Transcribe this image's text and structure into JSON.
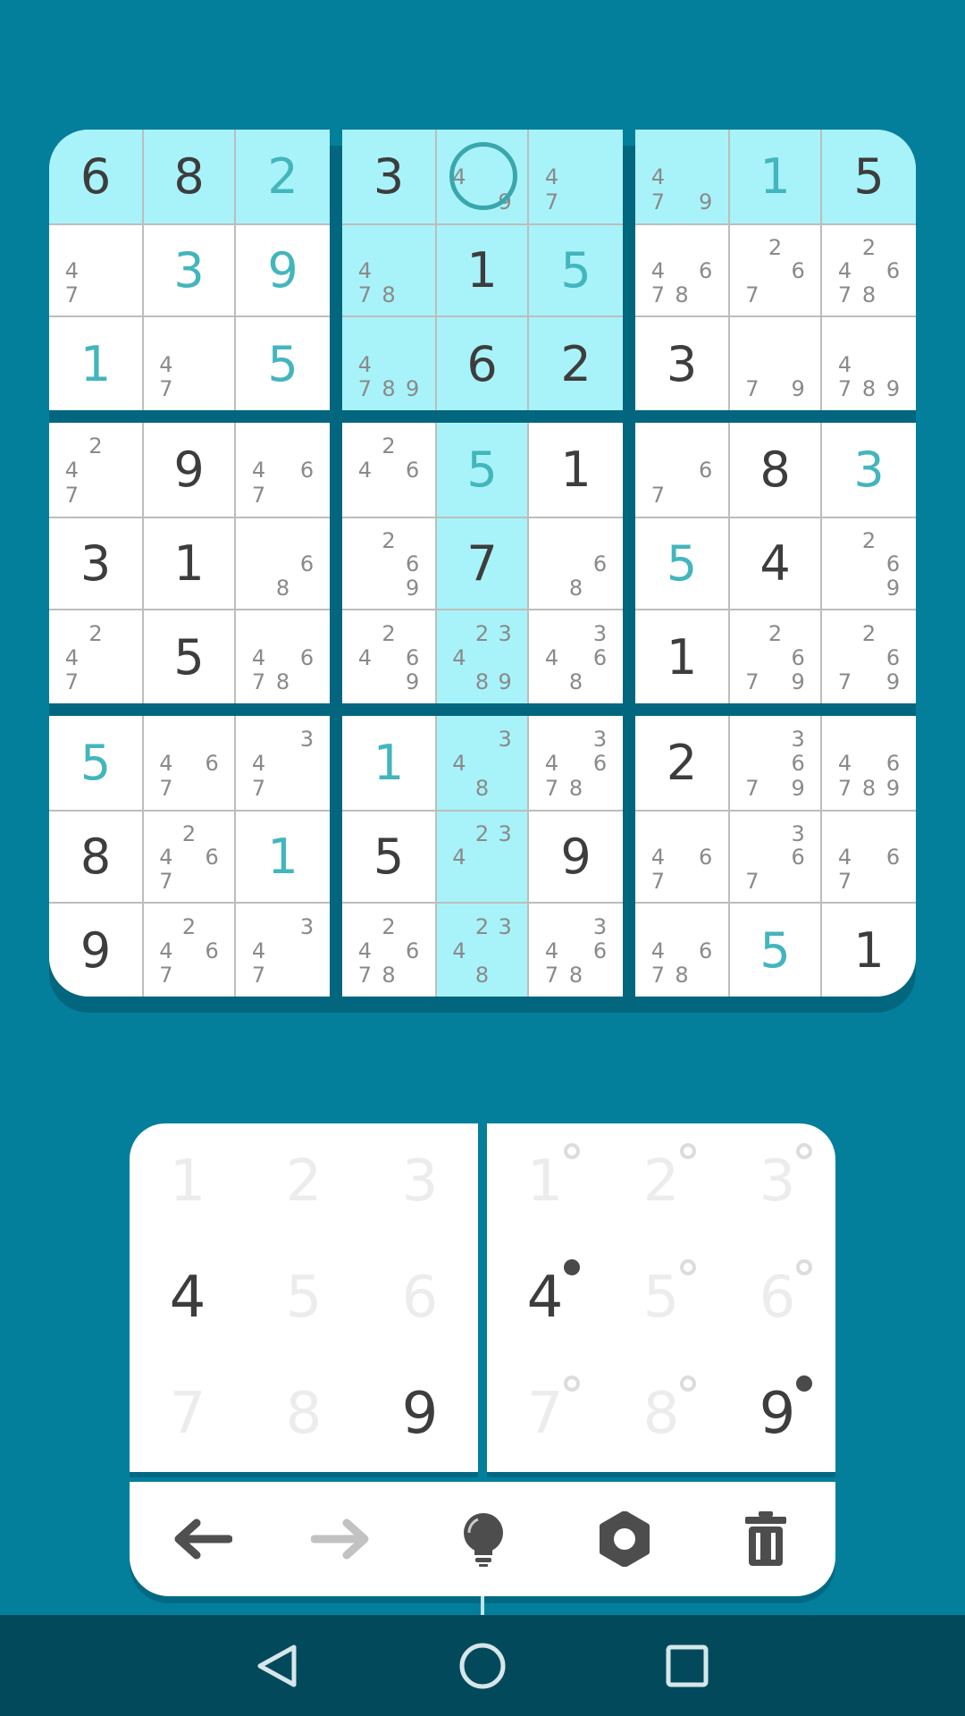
{
  "board": {
    "rows": [
      [
        {
          "v": "6"
        },
        {
          "v": "8"
        },
        {
          "v": "2",
          "g": true
        },
        {
          "v": "3"
        },
        {
          "n": [
            "4",
            "9"
          ]
        },
        {
          "n": [
            "4",
            "7"
          ]
        },
        {
          "n": [
            "4",
            "7",
            "9"
          ]
        },
        {
          "v": "1",
          "g": true
        },
        {
          "v": "5"
        }
      ],
      [
        {
          "n": [
            "4",
            "7"
          ]
        },
        {
          "v": "3",
          "g": true
        },
        {
          "v": "9",
          "g": true
        },
        {
          "n": [
            "4",
            "7",
            "8"
          ]
        },
        {
          "v": "1"
        },
        {
          "v": "5",
          "g": true
        },
        {
          "n": [
            "4",
            "6",
            "7",
            "8"
          ]
        },
        {
          "n": [
            "2",
            "6",
            "7"
          ]
        },
        {
          "n": [
            "2",
            "4",
            "6",
            "7",
            "8"
          ]
        }
      ],
      [
        {
          "v": "1",
          "g": true
        },
        {
          "n": [
            "4",
            "7"
          ]
        },
        {
          "v": "5",
          "g": true
        },
        {
          "n": [
            "4",
            "7",
            "8",
            "9"
          ]
        },
        {
          "v": "6"
        },
        {
          "v": "2"
        },
        {
          "v": "3"
        },
        {
          "n": [
            "7",
            "9"
          ]
        },
        {
          "n": [
            "4",
            "7",
            "8",
            "9"
          ]
        }
      ],
      [
        {
          "n": [
            "2",
            "4",
            "7"
          ]
        },
        {
          "v": "9"
        },
        {
          "n": [
            "4",
            "6",
            "7"
          ]
        },
        {
          "n": [
            "2",
            "4",
            "6"
          ]
        },
        {
          "v": "5",
          "g": true
        },
        {
          "v": "1"
        },
        {
          "n": [
            "6",
            "7"
          ]
        },
        {
          "v": "8"
        },
        {
          "v": "3",
          "g": true
        }
      ],
      [
        {
          "v": "3"
        },
        {
          "v": "1"
        },
        {
          "n": [
            "6",
            "8"
          ]
        },
        {
          "n": [
            "2",
            "6",
            "9"
          ]
        },
        {
          "v": "7"
        },
        {
          "n": [
            "6",
            "8"
          ]
        },
        {
          "v": "5",
          "g": true
        },
        {
          "v": "4"
        },
        {
          "n": [
            "2",
            "6",
            "9"
          ]
        }
      ],
      [
        {
          "n": [
            "2",
            "4",
            "7"
          ]
        },
        {
          "v": "5"
        },
        {
          "n": [
            "4",
            "6",
            "7",
            "8"
          ]
        },
        {
          "n": [
            "2",
            "4",
            "6",
            "9"
          ]
        },
        {
          "n": [
            "2",
            "3",
            "4",
            "8",
            "9"
          ]
        },
        {
          "n": [
            "3",
            "4",
            "6",
            "8"
          ]
        },
        {
          "v": "1"
        },
        {
          "n": [
            "2",
            "6",
            "7",
            "9"
          ]
        },
        {
          "n": [
            "2",
            "6",
            "7",
            "9"
          ]
        }
      ],
      [
        {
          "v": "5",
          "g": true
        },
        {
          "n": [
            "4",
            "6",
            "7"
          ]
        },
        {
          "n": [
            "3",
            "4",
            "7"
          ]
        },
        {
          "v": "1",
          "g": true
        },
        {
          "n": [
            "3",
            "4",
            "8"
          ]
        },
        {
          "n": [
            "3",
            "4",
            "6",
            "7",
            "8"
          ]
        },
        {
          "v": "2"
        },
        {
          "n": [
            "3",
            "6",
            "7",
            "9"
          ]
        },
        {
          "n": [
            "4",
            "6",
            "7",
            "8",
            "9"
          ]
        }
      ],
      [
        {
          "v": "8"
        },
        {
          "n": [
            "2",
            "4",
            "6",
            "7"
          ]
        },
        {
          "v": "1",
          "g": true
        },
        {
          "v": "5"
        },
        {
          "n": [
            "2",
            "3",
            "4"
          ]
        },
        {
          "v": "9"
        },
        {
          "n": [
            "4",
            "6",
            "7"
          ]
        },
        {
          "n": [
            "3",
            "6",
            "7"
          ]
        },
        {
          "n": [
            "4",
            "6",
            "7"
          ]
        }
      ],
      [
        {
          "v": "9"
        },
        {
          "n": [
            "2",
            "4",
            "6",
            "7"
          ]
        },
        {
          "n": [
            "3",
            "4",
            "7"
          ]
        },
        {
          "n": [
            "2",
            "4",
            "6",
            "7",
            "8"
          ]
        },
        {
          "n": [
            "2",
            "3",
            "4",
            "8"
          ]
        },
        {
          "n": [
            "3",
            "4",
            "6",
            "7",
            "8"
          ]
        },
        {
          "n": [
            "4",
            "6",
            "7",
            "8"
          ]
        },
        {
          "v": "5",
          "g": true
        },
        {
          "v": "1"
        }
      ]
    ],
    "selected": {
      "row": 0,
      "col": 4
    },
    "colors": {
      "given": "#3d3d3d",
      "entered": "#43b5bd",
      "highlight": "#a8f3f9",
      "background": "#037f9c"
    }
  },
  "value_pad": {
    "keys": [
      "1",
      "2",
      "3",
      "4",
      "5",
      "6",
      "7",
      "8",
      "9"
    ],
    "enabled": [
      false,
      false,
      false,
      true,
      false,
      false,
      false,
      false,
      true
    ]
  },
  "notes_pad": {
    "keys": [
      "1",
      "2",
      "3",
      "4",
      "5",
      "6",
      "7",
      "8",
      "9"
    ],
    "marked": [
      false,
      false,
      false,
      true,
      false,
      false,
      false,
      false,
      true
    ]
  },
  "toolbar": {
    "items": [
      {
        "icon": "undo-arrow-icon",
        "enabled": true
      },
      {
        "icon": "redo-arrow-icon",
        "enabled": false
      },
      {
        "icon": "hint-lightbulb-icon",
        "enabled": true
      },
      {
        "icon": "settings-gear-icon",
        "enabled": true
      },
      {
        "icon": "trash-icon",
        "enabled": true
      }
    ]
  },
  "navbar": {
    "items": [
      {
        "icon": "back-triangle-icon"
      },
      {
        "icon": "home-circle-icon"
      },
      {
        "icon": "recents-square-icon"
      }
    ]
  }
}
